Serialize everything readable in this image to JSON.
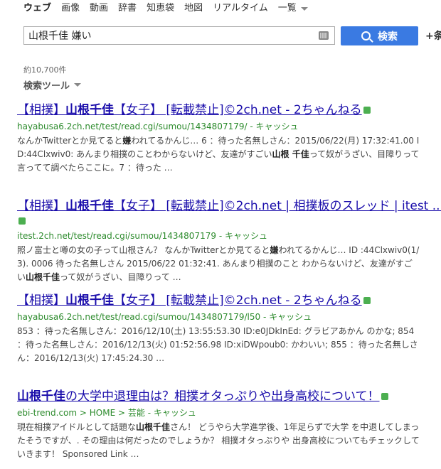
{
  "nav": {
    "items": [
      "ウェブ",
      "画像",
      "動画",
      "辞書",
      "知恵袋",
      "地図",
      "リアルタイム"
    ],
    "more": "一覧"
  },
  "search": {
    "value": "山根千佳 嫌い",
    "button": "検索",
    "extra": "+条"
  },
  "count": "約10,700件",
  "tools": "検索ツール",
  "results": [
    {
      "title_pre": "【相撲】",
      "title_bold": "山根千佳",
      "title_post": "【女子】 [転載禁止]©2ch.net - 2ちゃんねる",
      "url": "hayabusa6.2ch.net/test/read.cgi/sumou/1434807179/",
      "cache": "キャッシュ",
      "snippet": [
        {
          "t": "なんかTwitterとか見てると"
        },
        {
          "b": "嫌"
        },
        {
          "t": "われてるかんじ… 6 ：待った名無しさん：2015/06/22(月) 17:32:41.00 ID:44Clxwiv0: あんまり相撲のことわからないけど、友達がすごい"
        },
        {
          "b": "山根 千佳"
        },
        {
          "t": "って奴がうざい、目障りって言ってて調べたらここに。7 ：待った …"
        }
      ]
    },
    {
      "title_pre": "【相撲】",
      "title_bold": "山根千佳",
      "title_post": "【女子】 [転載禁止]©2ch.net | 相撲板のスレッド | itest ...",
      "url": "itest.2ch.net/test/read.cgi/sumou/1434807179",
      "cache": "キャッシュ",
      "snippet": [
        {
          "t": "照ノ富士と噂の女の子って山根さん？ なんかTwitterとか見てると"
        },
        {
          "b": "嫌"
        },
        {
          "t": "われてるかんじ… ID :44Clxwiv0(1/3). 0006 待った名無しさん 2015/06/22 01:32:41. あんまり相撲のこと わからないけど、友達がすごい"
        },
        {
          "b": "山根千佳"
        },
        {
          "t": "って奴がうざい、目障りって …"
        }
      ]
    },
    {
      "title_pre": "【相撲】",
      "title_bold": "山根千佳",
      "title_post": "【女子】 [転載禁止]©2ch.net - 2ちゃんねる",
      "url": "hayabusa6.2ch.net/test/read.cgi/sumou/1434807179/l50",
      "cache": "キャッシュ",
      "snippet": [
        {
          "t": "853 ：待った名無しさん：2016/12/10(土) 13:55:53.30 ID:e0JDkInEd: グラビアあかん のかな; 854 ：待った名無しさん：2016/12/13(火) 01:52:56.98 ID:xiDWpoub0: かわいい; 855 ：待った名無しさん：2016/12/13(火) 17:45:24.30 …"
        }
      ]
    },
    {
      "title_pre": "",
      "title_bold": "山根千佳",
      "title_post": "の大学中退理由は？相撲オタっぷりや出身高校について！",
      "url": "ebi-trend.com > HOME > 芸能",
      "cache": "キャッシュ",
      "snippet": [
        {
          "t": "現在相撲アイドルとして話題な"
        },
        {
          "b": "山根千佳"
        },
        {
          "t": "さん！ どうやら大学進学後、1年足らずで大学 を中退してしまったそうですが、. その理由は何だったのでしょうか？ 相撲オタっぷりや 出身高校についてもチェックしていきます！ Sponsored Link …"
        }
      ]
    }
  ]
}
